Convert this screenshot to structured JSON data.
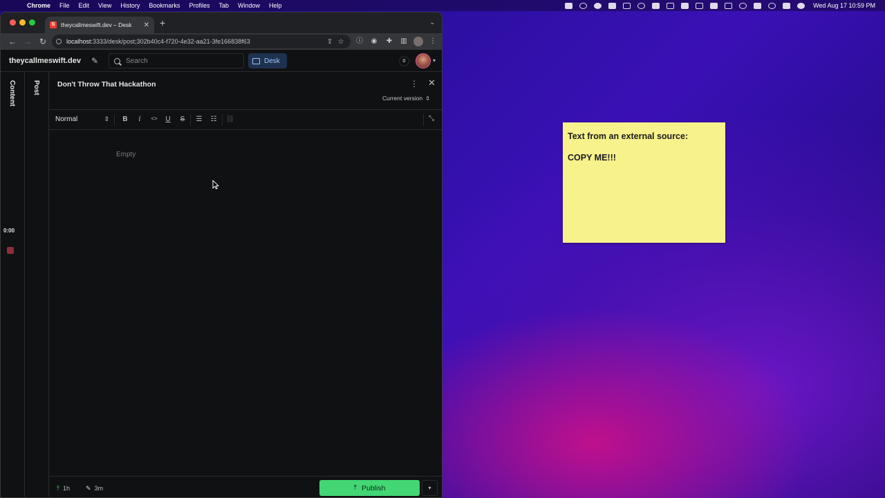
{
  "menubar": {
    "app_name": "Chrome",
    "items": [
      "File",
      "Edit",
      "View",
      "History",
      "Bookmarks",
      "Profiles",
      "Tab",
      "Window",
      "Help"
    ],
    "clock": "Wed Aug 17  10:59 PM"
  },
  "browser": {
    "tab_title": "theycallmeswift.dev – Desk",
    "favicon_letter": "S",
    "url_host": "localhost",
    "url_rest": ":3333/desk/post;302b40c4-f720-4e32-aa21-3fe166838f63"
  },
  "studio": {
    "brand": "theycallmeswift.dev",
    "search_placeholder": "Search",
    "desk_label": "Desk",
    "notification_count": "0",
    "panes": {
      "content": "Content",
      "post": "Post"
    },
    "recorder_time": "0:00"
  },
  "document": {
    "title": "Don't Throw That Hackathon",
    "version": "Current version",
    "style_select": "Normal",
    "format_buttons": [
      "B",
      "i",
      "<>",
      "U",
      "S"
    ],
    "placeholder": "Empty",
    "published_ago": "1h",
    "edited_ago": "3m",
    "publish_label": "Publish"
  },
  "sticky_note": {
    "line1": "Text from an external source:",
    "line2": "COPY ME!!!",
    "color": "#f8f28d"
  },
  "colors": {
    "publish_green": "#43d675",
    "desk_active_bg": "#1e3250",
    "studio_bg": "#101112"
  }
}
